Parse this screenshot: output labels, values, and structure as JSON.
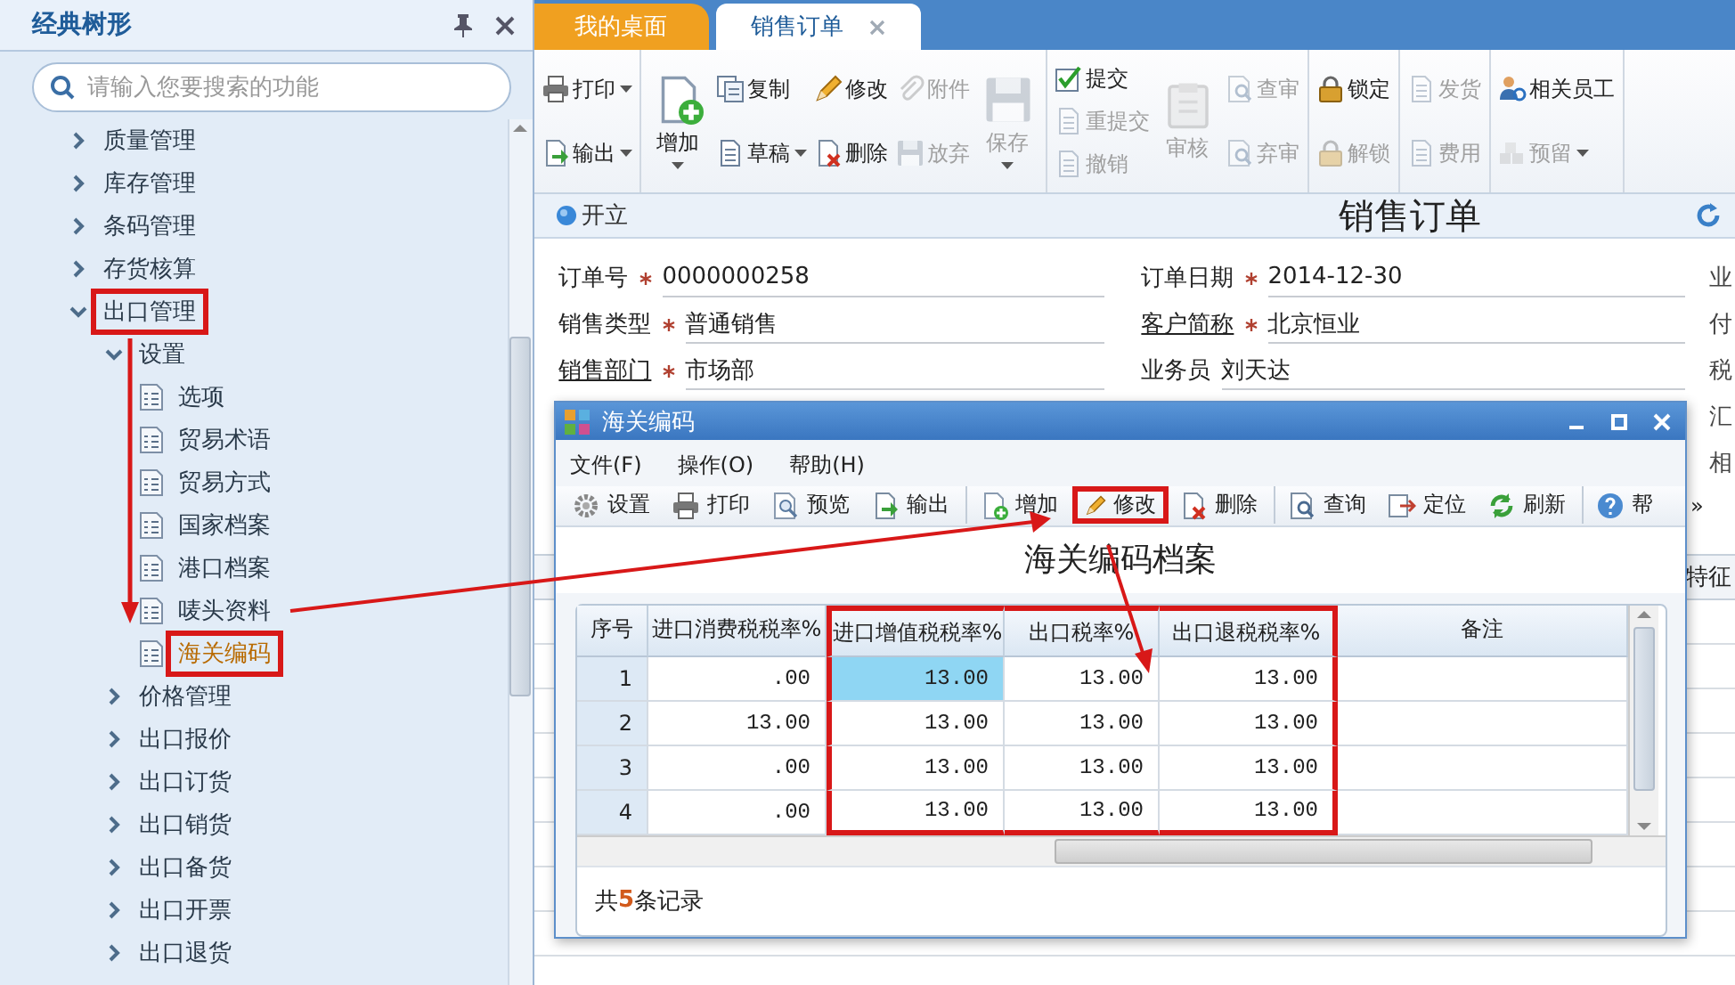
{
  "sidebar": {
    "title": "经典树形",
    "search": {
      "placeholder": "请输入您要搜索的功能"
    },
    "tree": [
      {
        "label": "质量管理",
        "kind": "folder",
        "expanded": false,
        "selected": false
      },
      {
        "label": "库存管理",
        "kind": "folder",
        "expanded": false,
        "selected": false
      },
      {
        "label": "条码管理",
        "kind": "folder",
        "expanded": false,
        "selected": false
      },
      {
        "label": "存货核算",
        "kind": "folder",
        "expanded": false,
        "selected": false
      },
      {
        "label": "出口管理",
        "kind": "folder",
        "expanded": true,
        "selected": false,
        "highlighted": true,
        "children": [
          {
            "label": "设置",
            "kind": "folder",
            "expanded": true,
            "selected": false,
            "children": [
              {
                "label": "选项",
                "kind": "leaf",
                "selected": false
              },
              {
                "label": "贸易术语",
                "kind": "leaf",
                "selected": false
              },
              {
                "label": "贸易方式",
                "kind": "leaf",
                "selected": false
              },
              {
                "label": "国家档案",
                "kind": "leaf",
                "selected": false
              },
              {
                "label": "港口档案",
                "kind": "leaf",
                "selected": false
              },
              {
                "label": "唛头资料",
                "kind": "leaf",
                "selected": false
              },
              {
                "label": "海关编码",
                "kind": "leaf",
                "selected": true,
                "highlighted": true
              }
            ]
          },
          {
            "label": "价格管理",
            "kind": "folder",
            "expanded": false,
            "selected": false
          },
          {
            "label": "出口报价",
            "kind": "folder",
            "expanded": false,
            "selected": false
          },
          {
            "label": "出口订货",
            "kind": "folder",
            "expanded": false,
            "selected": false
          },
          {
            "label": "出口销货",
            "kind": "folder",
            "expanded": false,
            "selected": false
          },
          {
            "label": "出口备货",
            "kind": "folder",
            "expanded": false,
            "selected": false
          },
          {
            "label": "出口开票",
            "kind": "folder",
            "expanded": false,
            "selected": false
          },
          {
            "label": "出口退货",
            "kind": "folder",
            "expanded": false,
            "selected": false
          }
        ]
      }
    ]
  },
  "tabs": [
    {
      "label": "我的桌面",
      "selected": false,
      "closable": false
    },
    {
      "label": "销售订单",
      "selected": true,
      "closable": true
    }
  ],
  "toolbar": [
    {
      "columns": [
        {
          "kind": "stack",
          "items": [
            {
              "label": "打印",
              "disabled": false,
              "dropdown": true
            },
            {
              "label": "输出",
              "disabled": false,
              "dropdown": true
            }
          ]
        }
      ]
    },
    {
      "columns": [
        {
          "kind": "big",
          "items": [
            {
              "label": "增加",
              "disabled": false,
              "dropdown": true
            }
          ]
        },
        {
          "kind": "stack",
          "items": [
            {
              "label": "复制",
              "disabled": false,
              "dropdown": false
            },
            {
              "label": "草稿",
              "disabled": false,
              "dropdown": true
            }
          ]
        },
        {
          "kind": "stack",
          "items": [
            {
              "label": "修改",
              "disabled": false,
              "dropdown": false
            },
            {
              "label": "删除",
              "disabled": false,
              "dropdown": false
            }
          ]
        },
        {
          "kind": "stack",
          "items": [
            {
              "label": "附件",
              "disabled": true,
              "dropdown": false
            },
            {
              "label": "放弃",
              "disabled": true,
              "dropdown": false
            }
          ]
        },
        {
          "kind": "big",
          "items": [
            {
              "label": "保存",
              "disabled": true,
              "dropdown": true
            }
          ]
        }
      ]
    },
    {
      "columns": [
        {
          "kind": "stack",
          "items": [
            {
              "label": "提交",
              "disabled": false,
              "dropdown": false
            },
            {
              "label": "重提交",
              "disabled": true,
              "dropdown": false
            },
            {
              "label": "撤销",
              "disabled": true,
              "dropdown": false
            }
          ]
        },
        {
          "kind": "big",
          "items": [
            {
              "label": "审核",
              "disabled": true,
              "dropdown": false
            }
          ]
        },
        {
          "kind": "stack",
          "items": [
            {
              "label": "查审",
              "disabled": true,
              "dropdown": false
            },
            {
              "label": "弃审",
              "disabled": true,
              "dropdown": false
            }
          ]
        }
      ]
    },
    {
      "columns": [
        {
          "kind": "stack",
          "items": [
            {
              "label": "锁定",
              "disabled": false,
              "dropdown": false
            },
            {
              "label": "解锁",
              "disabled": true,
              "dropdown": false
            }
          ]
        }
      ]
    },
    {
      "columns": [
        {
          "kind": "stack",
          "items": [
            {
              "label": "发货",
              "disabled": true,
              "dropdown": false
            },
            {
              "label": "费用",
              "disabled": true,
              "dropdown": false
            }
          ]
        }
      ]
    },
    {
      "columns": [
        {
          "kind": "stack",
          "items": [
            {
              "label": "相关员工",
              "disabled": false,
              "dropdown": false
            },
            {
              "label": "预留",
              "disabled": true,
              "dropdown": true
            }
          ]
        }
      ]
    }
  ],
  "status": "开立",
  "document_title": "销售订单",
  "form": {
    "rows": [
      [
        {
          "label": "订单号",
          "required": true,
          "link": false,
          "value": "0000000258"
        },
        {
          "label": "订单日期",
          "required": true,
          "link": false,
          "value": "2014-12-30"
        }
      ],
      [
        {
          "label": "销售类型",
          "required": true,
          "link": false,
          "value": "普通销售"
        },
        {
          "label": "客户简称",
          "required": true,
          "link": true,
          "value": "北京恒业"
        }
      ],
      [
        {
          "label": "销售部门",
          "required": true,
          "link": true,
          "value": "市场部"
        },
        {
          "label": "业务员",
          "required": false,
          "link": false,
          "value": "刘天达"
        }
      ]
    ],
    "column_3": [
      "业",
      "付",
      "税",
      "汇",
      "相"
    ]
  },
  "detail_grid": {
    "column_header": "特征"
  },
  "dialog": {
    "title": "海关编码",
    "menu": [
      "文件(F)",
      "操作(O)",
      "帮助(H)"
    ],
    "toolbar": [
      [
        {
          "label": "设置",
          "highlighted": false
        },
        {
          "label": "打印",
          "highlighted": false
        },
        {
          "label": "预览",
          "highlighted": false
        },
        {
          "label": "输出",
          "highlighted": false
        }
      ],
      [
        {
          "label": "增加",
          "highlighted": false
        },
        {
          "label": "修改",
          "highlighted": true
        },
        {
          "label": "删除",
          "highlighted": false
        }
      ],
      [
        {
          "label": "查询",
          "highlighted": false
        },
        {
          "label": "定位",
          "highlighted": false
        },
        {
          "label": "刷新",
          "highlighted": false
        }
      ],
      [
        {
          "label": "帮",
          "highlighted": false
        }
      ]
    ],
    "toolbar_overflow": "»",
    "heading": "海关编码档案",
    "table": {
      "columns": [
        {
          "label": "序号",
          "highlighted": false
        },
        {
          "label": "进口消费税税率%",
          "highlighted": false
        },
        {
          "label": "进口增值税税率%",
          "highlighted": true
        },
        {
          "label": "出口税率%",
          "highlighted": true
        },
        {
          "label": "出口退税税率%",
          "highlighted": true
        },
        {
          "label": "备注",
          "highlighted": false
        }
      ],
      "rows": [
        {
          "cells": [
            {
              "text": "1",
              "selected": false
            },
            {
              "text": ".00",
              "selected": false
            },
            {
              "text": "13.00",
              "selected": true
            },
            {
              "text": "13.00",
              "selected": false
            },
            {
              "text": "13.00",
              "selected": false
            }
          ]
        },
        {
          "cells": [
            {
              "text": "2",
              "selected": false
            },
            {
              "text": "13.00",
              "selected": false
            },
            {
              "text": "13.00",
              "selected": false
            },
            {
              "text": "13.00",
              "selected": false
            },
            {
              "text": "13.00",
              "selected": false
            }
          ]
        },
        {
          "cells": [
            {
              "text": "3",
              "selected": false
            },
            {
              "text": ".00",
              "selected": false
            },
            {
              "text": "13.00",
              "selected": false
            },
            {
              "text": "13.00",
              "selected": false
            },
            {
              "text": "13.00",
              "selected": false
            }
          ]
        },
        {
          "cells": [
            {
              "text": "4",
              "selected": false
            },
            {
              "text": ".00",
              "selected": false
            },
            {
              "text": "13.00",
              "selected": false
            },
            {
              "text": "13.00",
              "selected": false
            },
            {
              "text": "13.00",
              "selected": false
            }
          ]
        }
      ]
    },
    "footer": "共**5**条记录"
  }
}
